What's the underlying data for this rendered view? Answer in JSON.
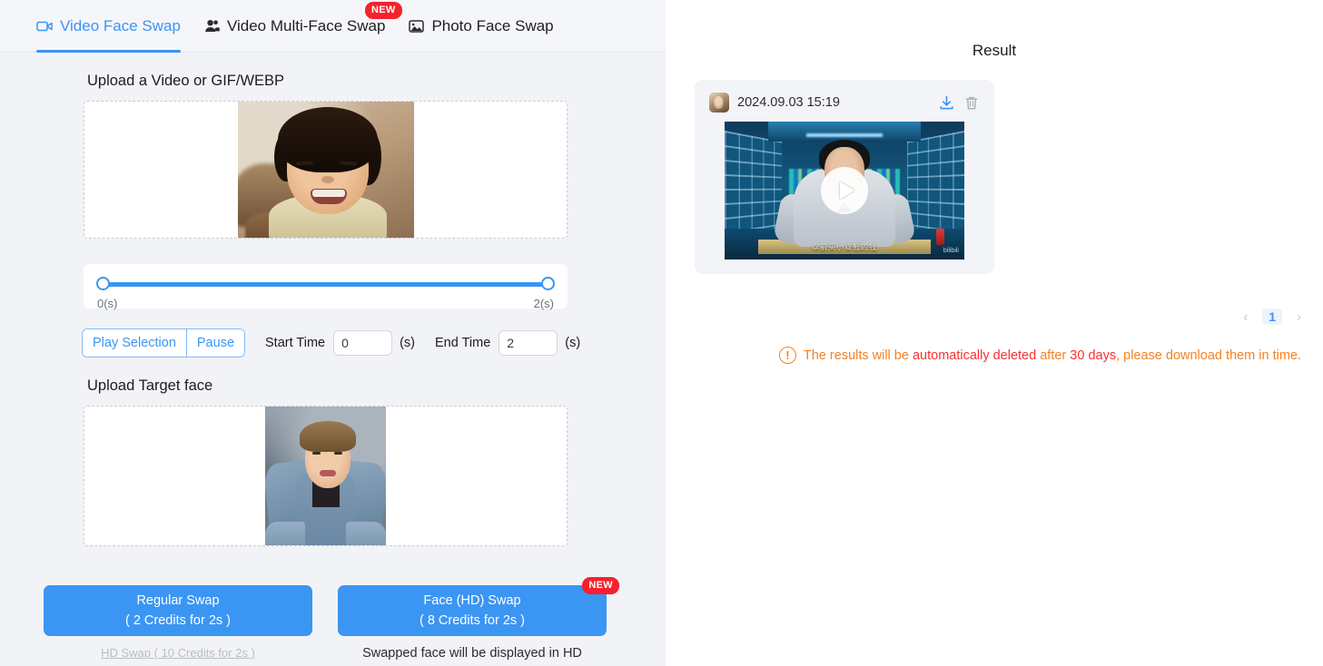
{
  "tabs": [
    {
      "label": "Video Face Swap",
      "icon": "video-camera-icon",
      "active": true
    },
    {
      "label": "Video Multi-Face Swap",
      "icon": "people-icon",
      "active": false,
      "badge": "NEW"
    },
    {
      "label": "Photo Face Swap",
      "icon": "image-icon",
      "active": false
    }
  ],
  "badges": {
    "new": "NEW"
  },
  "upload": {
    "source_label": "Upload a Video or GIF/WEBP",
    "target_label": "Upload Target face"
  },
  "slider": {
    "start_label": "0(s)",
    "end_label": "2(s)",
    "start_value": 0,
    "end_value": 2
  },
  "controls": {
    "play_selection": "Play Selection",
    "pause": "Pause",
    "start_time_label": "Start Time",
    "start_time_value": "0",
    "unit_1": "(s)",
    "end_time_label": "End Time",
    "end_time_value": "2",
    "unit_2": "(s)"
  },
  "actions": {
    "regular": {
      "title": "Regular Swap",
      "credits": "( 2 Credits for 2s )",
      "note": "HD Swap ( 10 Credits for 2s )"
    },
    "hd": {
      "title": "Face (HD) Swap",
      "credits": "( 8 Credits for 2s )",
      "note": "Swapped face will be displayed in HD",
      "badge": "NEW"
    }
  },
  "result": {
    "title": "Result",
    "items": [
      {
        "timestamp": "2024.09.03 15:19",
        "download_icon": "download-icon",
        "delete_icon": "trash-icon",
        "play_icon": "play-icon",
        "video_subtitle": "以前买小双鞋的钱",
        "video_watermark": "bilibili"
      }
    ],
    "pagination": {
      "prev": "‹",
      "page": "1",
      "next": "›"
    },
    "warning": {
      "prefix": "The results will be ",
      "highlight_1": "automatically deleted",
      "middle": " after ",
      "highlight_2": "30 days",
      "suffix": ", please download them in time."
    }
  },
  "colors": {
    "accent": "#3b95f3",
    "badge": "#f5222d",
    "warning": "#f58220",
    "warning_strong": "#fb2f2f",
    "panel_bg": "#f2f3f7"
  }
}
